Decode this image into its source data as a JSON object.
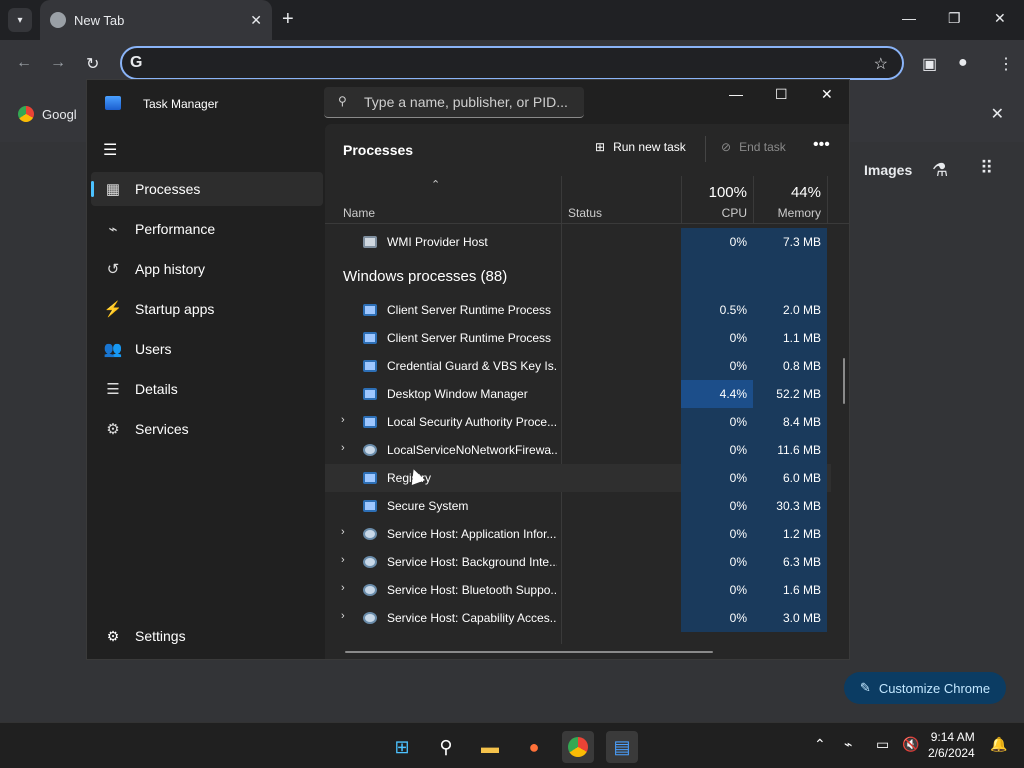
{
  "browser": {
    "tab_title": "New Tab",
    "bookmark_label": "Googl",
    "ntp_images": "Images",
    "customize_label": "Customize Chrome"
  },
  "taskmanager": {
    "title": "Task Manager",
    "search_placeholder": "Type a name, publisher, or PID...",
    "nav": [
      "Processes",
      "Performance",
      "App history",
      "Startup apps",
      "Users",
      "Details",
      "Services"
    ],
    "settings_label": "Settings",
    "page_title": "Processes",
    "run_new_task": "Run new task",
    "end_task": "End task",
    "columns": {
      "name": "Name",
      "status": "Status",
      "cpu_pct": "100%",
      "cpu": "CPU",
      "mem_pct": "44%",
      "memory": "Memory"
    },
    "top_row": {
      "name": "WMI Provider Host",
      "cpu": "0%",
      "mem": "7.3 MB"
    },
    "group_label": "Windows processes (88)",
    "rows": [
      {
        "name": "Client Server Runtime Process",
        "cpu": "0.5%",
        "mem": "2.0 MB",
        "expand": false,
        "icon": "window-icon"
      },
      {
        "name": "Client Server Runtime Process",
        "cpu": "0%",
        "mem": "1.1 MB",
        "expand": false,
        "icon": "window-icon"
      },
      {
        "name": "Credential Guard & VBS Key Is...",
        "cpu": "0%",
        "mem": "0.8 MB",
        "expand": false,
        "icon": "window-icon"
      },
      {
        "name": "Desktop Window Manager",
        "cpu": "4.4%",
        "mem": "52.2 MB",
        "expand": false,
        "icon": "window-icon"
      },
      {
        "name": "Local Security Authority Proce...",
        "cpu": "0%",
        "mem": "8.4 MB",
        "expand": true,
        "icon": "window-icon"
      },
      {
        "name": "LocalServiceNoNetworkFirewa...",
        "cpu": "0%",
        "mem": "11.6 MB",
        "expand": true,
        "icon": "gear-icon"
      },
      {
        "name": "Registry",
        "cpu": "0%",
        "mem": "6.0 MB",
        "expand": false,
        "icon": "window-icon"
      },
      {
        "name": "Secure System",
        "cpu": "0%",
        "mem": "30.3 MB",
        "expand": false,
        "icon": "window-icon"
      },
      {
        "name": "Service Host: Application Infor...",
        "cpu": "0%",
        "mem": "1.2 MB",
        "expand": true,
        "icon": "gear-icon"
      },
      {
        "name": "Service Host: Background Inte...",
        "cpu": "0%",
        "mem": "6.3 MB",
        "expand": true,
        "icon": "gear-icon"
      },
      {
        "name": "Service Host: Bluetooth Suppo...",
        "cpu": "0%",
        "mem": "1.6 MB",
        "expand": true,
        "icon": "gear-icon"
      },
      {
        "name": "Service Host: Capability Acces...",
        "cpu": "0%",
        "mem": "3.0 MB",
        "expand": true,
        "icon": "gear-icon"
      }
    ]
  },
  "taskbar": {
    "time": "9:14 AM",
    "date": "2/6/2024"
  }
}
